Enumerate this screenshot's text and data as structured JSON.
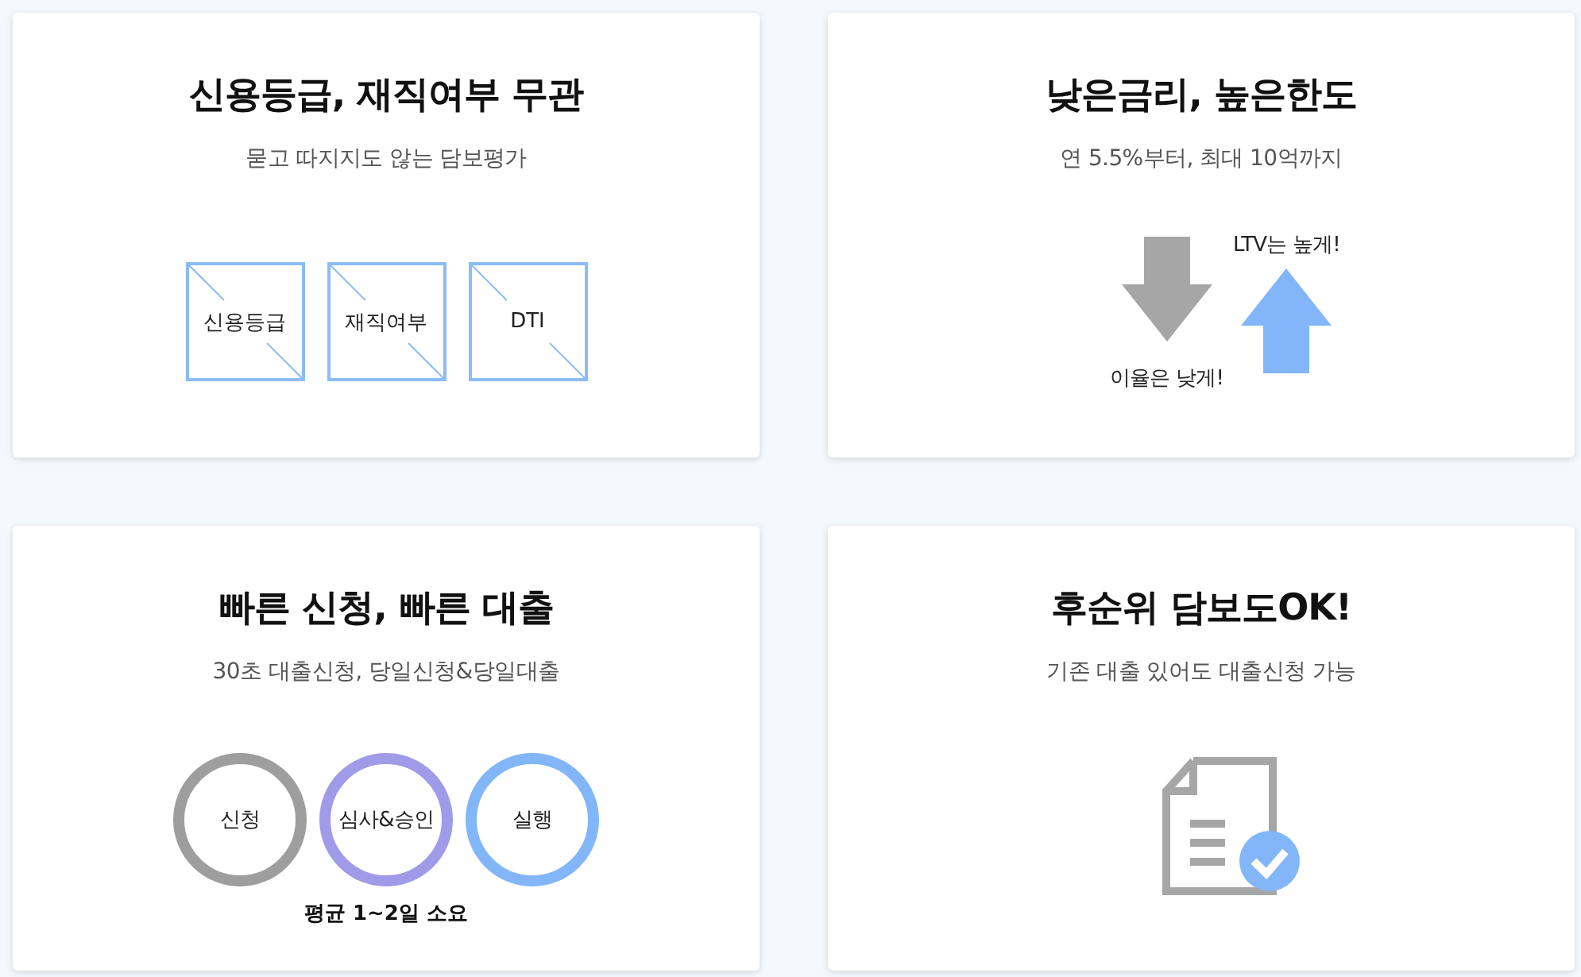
{
  "cards": [
    {
      "kind": "boxes",
      "title": "신용등급, 재직여부 무관",
      "subtitle": "묻고 따지지도 않는 담보평가",
      "items": [
        {
          "label": "신용등급"
        },
        {
          "label": "재직여부"
        },
        {
          "label": "DTI"
        }
      ]
    },
    {
      "kind": "arrows",
      "title": "낮은금리, 높은한도",
      "subtitle": "연 5.5%부터, 최대 10억까지",
      "down_label": "이율은 낮게!",
      "up_label": "LTV는 높게!"
    },
    {
      "kind": "circles",
      "title": "빠른 신청, 빠른 대출",
      "subtitle": "30초 대출신청, 당일신청&당일대출",
      "items": [
        {
          "label": "신청",
          "color": "#9e9e9e"
        },
        {
          "label": "심사&승인",
          "color": "#a09be8"
        },
        {
          "label": "실행",
          "color": "#82b6f8"
        }
      ],
      "note": "평균 1~2일 소요"
    },
    {
      "kind": "document",
      "title": "후순위 담보도OK!",
      "subtitle": "기존 대출 있어도 대출신청 가능"
    }
  ]
}
